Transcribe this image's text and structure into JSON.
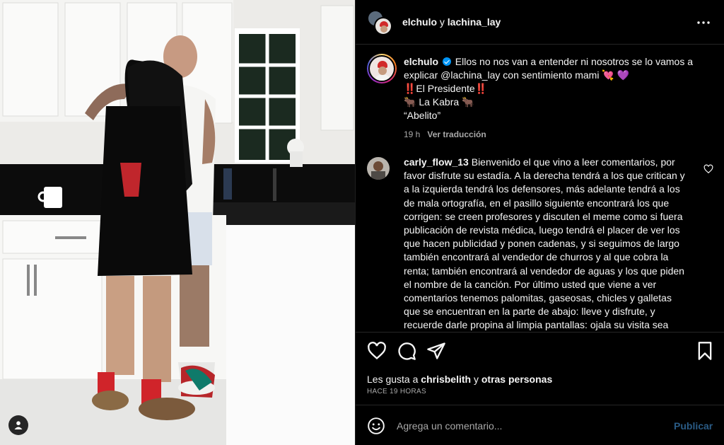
{
  "post": {
    "header": {
      "user1": "elchulo",
      "connector": "y",
      "user2": "lachina_lay"
    },
    "caption": {
      "username": "elchulo",
      "lines": [
        "Ellos no nos van a entender ni nosotros se lo vamos a",
        "explicar @lachina_lay con sentimiento mami 💘 💜",
        "‼️El Presidente‼️",
        "🐂 La Kabra 🐂",
        "“Abelito”"
      ],
      "time": "19 h",
      "translate": "Ver traducción"
    },
    "comment": {
      "username": "carly_flow_13",
      "text": "Bienvenido el que vino a leer comentarios, por favor disfrute su estadía. A la derecha tendrá a los que critican y a la izquierda tendrá los defensores, más adelante tendrá a los de mala ortografía, en el pasillo siguiente encontrará los que corrigen: se creen profesores y discuten el meme como si fuera publicación de revista médica, luego tendrá el placer de ver los que hacen publicidad y ponen cadenas, y si seguimos de largo también encontrará al vendedor de churros y al que cobra la renta; también encontrará al vendedor de aguas y los que piden el nombre de la canción. Por último usted que viene a ver comentarios tenemos palomitas, gaseosas, chicles y galletas que se encuentran en la parte de abajo: lleve y disfrute, y recuerde darle propina al limpia pantallas: ojala su visita sea"
    },
    "likes": {
      "prefix": "Les gusta a",
      "user": "chrisbelith",
      "connector": "y",
      "others": "otras personas"
    },
    "timestamp": "HACE 19 HORAS",
    "add_comment": {
      "placeholder": "Agrega un comentario...",
      "post_label": "Publicar"
    }
  },
  "colors": {
    "accent": "#0095f6",
    "post_disabled": "#2a5b85",
    "border": "#262626",
    "muted": "#a8a8a8"
  },
  "icons": [
    "more-options-icon",
    "verified-icon",
    "heart-icon",
    "comment-icon",
    "share-icon",
    "bookmark-icon",
    "emoji-icon",
    "user-tag-icon"
  ]
}
